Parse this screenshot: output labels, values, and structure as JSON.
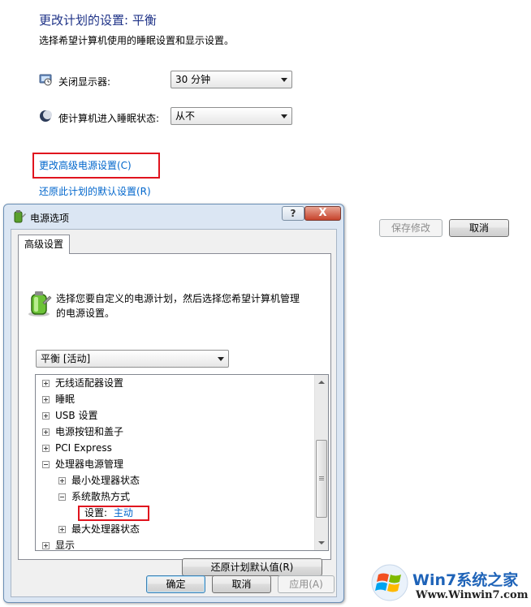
{
  "page": {
    "title": "更改计划的设置: 平衡",
    "description": "选择希望计算机使用的睡眠设置和显示设置。",
    "settings": [
      {
        "label": "关闭显示器:",
        "value": "30 分钟",
        "icon": "monitor-icon"
      },
      {
        "label": "使计算机进入睡眠状态:",
        "value": "从不",
        "icon": "moon-sleep-icon"
      }
    ],
    "links": {
      "advanced": "更改高级电源设置(C)",
      "restore": "还原此计划的默认设置(R)"
    },
    "buttons": {
      "save": "保存修改",
      "cancel": "取消"
    }
  },
  "dialog": {
    "title": "电源选项",
    "help_label": "?",
    "close_label": "X",
    "tab": "高级设置",
    "intro": "选择您要自定义的电源计划，然后选择您希望计算机管理的电源设置。",
    "plan_select": "平衡 [活动]",
    "tree": [
      {
        "label": "无线适配器设置",
        "level": 0,
        "state": "collapsed"
      },
      {
        "label": "睡眠",
        "level": 0,
        "state": "collapsed"
      },
      {
        "label": "USB 设置",
        "level": 0,
        "state": "collapsed"
      },
      {
        "label": "电源按钮和盖子",
        "level": 0,
        "state": "collapsed"
      },
      {
        "label": "PCI Express",
        "level": 0,
        "state": "collapsed"
      },
      {
        "label": "处理器电源管理",
        "level": 0,
        "state": "expanded"
      },
      {
        "label": "最小处理器状态",
        "level": 1,
        "state": "collapsed"
      },
      {
        "label": "系统散热方式",
        "level": 1,
        "state": "expanded"
      },
      {
        "label": "设置:",
        "value": "主动",
        "level": 2,
        "state": "leaf"
      },
      {
        "label": "最大处理器状态",
        "level": 1,
        "state": "collapsed"
      },
      {
        "label": "显示",
        "level": 0,
        "state": "collapsed"
      }
    ],
    "restore_defaults": "还原计划默认值(R)",
    "ok": "确定",
    "cancel": "取消",
    "apply": "应用(A)"
  },
  "watermark": {
    "brand": "Win7系统之家",
    "url": "Www.Winwin7.com"
  },
  "colors": {
    "title_blue": "#1e3287",
    "link_blue": "#0066cc",
    "highlight_red": "#e0141e",
    "dialog_frame": "#dbe6f3"
  }
}
